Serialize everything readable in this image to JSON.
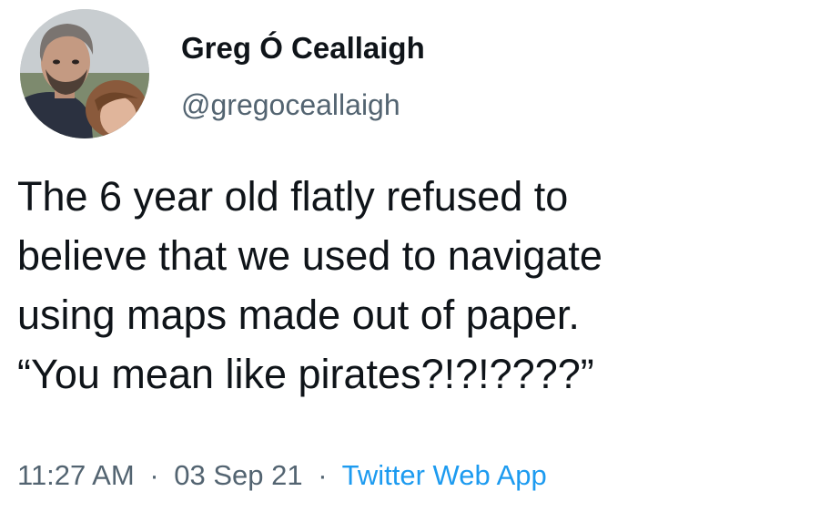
{
  "author": {
    "display_name": "Greg Ó Ceallaigh",
    "handle": "@gregoceallaigh"
  },
  "tweet": {
    "lines": [
      "The 6 year old flatly refused to",
      "believe that we used to navigate",
      "using maps made out of paper.",
      "“You mean like pirates?!?!????”"
    ]
  },
  "meta": {
    "time": "11:27 AM",
    "separator": "·",
    "date": "03 Sep 21",
    "source": "Twitter Web App"
  },
  "colors": {
    "text": "#0f1419",
    "secondary": "#536471",
    "link": "#1d9bf0",
    "background": "#ffffff"
  }
}
